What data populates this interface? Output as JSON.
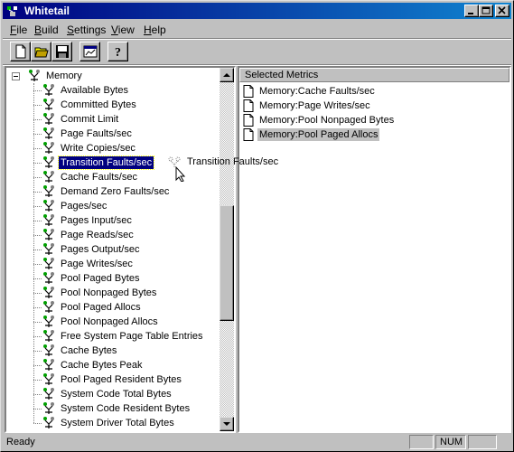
{
  "window": {
    "title": "Whitetail"
  },
  "menu": [
    {
      "label": "File",
      "mnemonic": "F"
    },
    {
      "label": "Build",
      "mnemonic": "B"
    },
    {
      "label": "Settings",
      "mnemonic": "S"
    },
    {
      "label": "View",
      "mnemonic": "V"
    },
    {
      "label": "Help",
      "mnemonic": "H"
    }
  ],
  "toolbar": [
    "new-file-icon",
    "open-folder-icon",
    "save-disk-icon",
    "chart-icon",
    "help-icon"
  ],
  "tree": {
    "root": "Memory",
    "items": [
      "Available Bytes",
      "Committed Bytes",
      "Commit Limit",
      "Page Faults/sec",
      "Write Copies/sec",
      "Transition Faults/sec",
      "Cache Faults/sec",
      "Demand Zero Faults/sec",
      "Pages/sec",
      "Pages Input/sec",
      "Page Reads/sec",
      "Pages Output/sec",
      "Page Writes/sec",
      "Pool Paged Bytes",
      "Pool Nonpaged Bytes",
      "Pool Paged Allocs",
      "Pool Nonpaged Allocs",
      "Free System Page Table Entries",
      "Cache Bytes",
      "Cache Bytes Peak",
      "Pool Paged Resident Bytes",
      "System Code Total Bytes",
      "System Code Resident Bytes",
      "System Driver Total Bytes"
    ],
    "selected_index": 5
  },
  "selected_metrics": {
    "header": "Selected Metrics",
    "items": [
      "Memory:Cache Faults/sec",
      "Memory:Page Writes/sec",
      "Memory:Pool Nonpaged Bytes",
      "Memory:Pool Paged Allocs"
    ],
    "highlight_index": 3
  },
  "drag": {
    "label": "Transition Faults/sec"
  },
  "status": {
    "text": "Ready",
    "indicators": [
      "",
      "NUM",
      ""
    ]
  },
  "colors": {
    "title_start": "#000080",
    "title_end": "#1084d0",
    "selection": "#000080",
    "face": "#c0c0c0"
  }
}
